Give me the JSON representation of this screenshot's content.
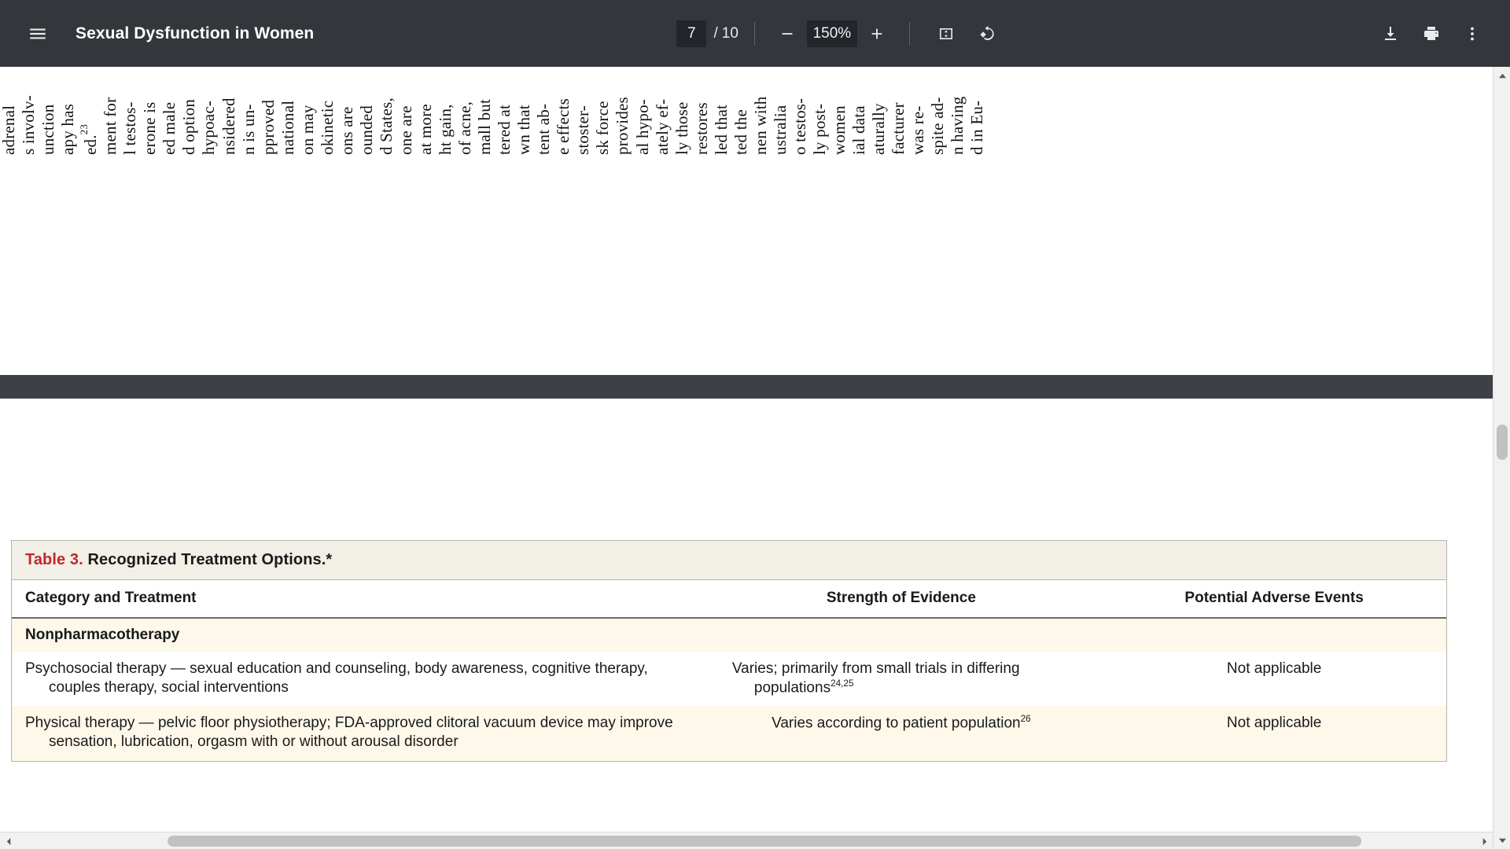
{
  "toolbar": {
    "menu_icon": "hamburger-menu-icon",
    "title": "Sexual Dysfunction in Women",
    "page_current": "7",
    "page_separator": "/",
    "page_total": "10",
    "zoom_out_icon": "minus-icon",
    "zoom_level": "150%",
    "zoom_in_icon": "plus-icon",
    "fit_page_icon": "fit-to-page-icon",
    "rotate_icon": "rotate-counterclockwise-icon",
    "download_icon": "download-icon",
    "print_icon": "print-icon",
    "more_icon": "more-vertical-icon"
  },
  "previous_page_fragment": {
    "note": "Bottom edge of the preceding rotated (sideways) page; text runs vertically.",
    "columns": [
      "adrenal",
      "s involv-",
      "unction",
      "apy has",
      "ed.<sup>23</sup>",
      "ment for",
      "l testos-",
      "erone is",
      "ed male",
      "d option",
      "hypoac-",
      "nsidered",
      "n is un-",
      "pproved",
      "national",
      "on may",
      "okinetic",
      "ons are",
      "ounded",
      "d States,",
      "one are",
      "at more",
      "ht gain,",
      "of acne,",
      "mall but",
      "tered at",
      "wn that",
      "tent ab-",
      "e effects",
      "stoster-",
      "sk force",
      "provides",
      "al hypo-",
      "ately ef-",
      "ly those",
      "restores",
      "led that",
      "ted the",
      "nen with",
      "ustralia",
      "o testos-",
      "ly post-",
      "women",
      "ial data",
      "aturally",
      "facturer",
      "was re-",
      "spite ad-",
      "n having",
      "d in Eu-"
    ]
  },
  "table": {
    "caption_number": "Table 3.",
    "caption_title": "Recognized Treatment Options.*",
    "headers": [
      "Category and Treatment",
      "Strength of Evidence",
      "Potential Adverse Events"
    ],
    "rows": [
      {
        "type": "section",
        "label": "Nonpharmacotherapy"
      },
      {
        "type": "data",
        "category": "Psychosocial therapy — sexual education and counseling, body awareness, cognitive therapy, couples therapy, social interventions",
        "evidence": "Varies; primarily from small trials in differing populations",
        "evidence_refs": "24,25",
        "adverse": "Not applicable"
      },
      {
        "type": "data",
        "category": "Physical therapy — pelvic floor physiotherapy; FDA-approved clitoral vacuum device may improve sensation, lubrication, orgasm with or without arousal disorder",
        "evidence": "Varies according to patient population",
        "evidence_refs": "26",
        "adverse": "Not applicable"
      }
    ]
  },
  "colors": {
    "toolbar_background": "#33373b",
    "caption_accent_red": "#c1272d",
    "table_row_cream": "#fdf8e9",
    "caption_background": "#f2efe6",
    "page_gap": "#3d4045"
  },
  "scrollbars": {
    "vertical_up_icon": "scroll-up-arrow-icon",
    "vertical_down_icon": "scroll-down-arrow-icon",
    "horizontal_left_icon": "scroll-left-arrow-icon",
    "horizontal_right_icon": "scroll-right-arrow-icon"
  }
}
